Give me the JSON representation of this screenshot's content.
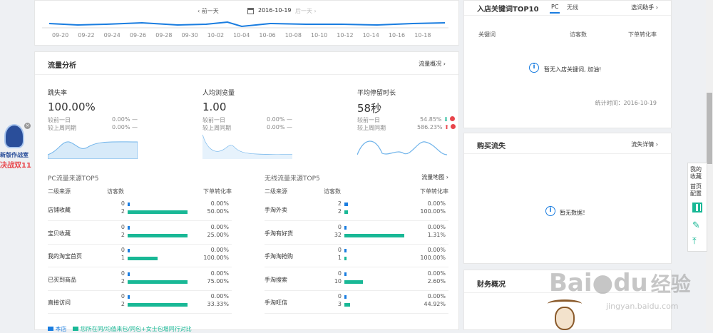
{
  "date_nav": {
    "prev": "前一天",
    "date": "2016-10-19",
    "next": "后一天"
  },
  "top_axis": {
    "ticks": [
      "09-20",
      "09-22",
      "09-24",
      "09-26",
      "09-28",
      "09-30",
      "10-02",
      "10-04",
      "10-06",
      "10-08",
      "10-10",
      "10-12",
      "10-14",
      "10-16",
      "10-18"
    ]
  },
  "traffic": {
    "title": "流量分析",
    "overview_link": "流量概况",
    "metrics": [
      {
        "label": "跳失率",
        "value": "100.00%",
        "day_label": "较前一日",
        "day_val": "0.00%",
        "week_label": "较上周同期",
        "week_val": "0.00%"
      },
      {
        "label": "人均浏览量",
        "value": "1.00",
        "day_label": "较前一日",
        "day_val": "0.00%",
        "week_label": "较上周同期",
        "week_val": "0.00%"
      },
      {
        "label": "平均停留时长",
        "value": "58秒",
        "day_label": "较前一日",
        "day_val": "54.85%",
        "week_label": "较上周同期",
        "week_val": "586.23%"
      }
    ],
    "dash": "—",
    "pc_top5": {
      "title": "PC流量来源TOP5",
      "cols": [
        "二级来源",
        "访客数",
        "下单转化率"
      ],
      "rows": [
        {
          "name": "店铺收藏",
          "a": "0",
          "b": "2",
          "ra": "0.00%",
          "rb": "50.00%",
          "fa": 0.0,
          "fb": 1.0
        },
        {
          "name": "宝贝收藏",
          "a": "0",
          "b": "2",
          "ra": "0.00%",
          "rb": "25.00%",
          "fa": 0.0,
          "fb": 1.0
        },
        {
          "name": "我的淘宝首页",
          "a": "0",
          "b": "1",
          "ra": "0.00%",
          "rb": "100.00%",
          "fa": 0.0,
          "fb": 0.5
        },
        {
          "name": "已买到商品",
          "a": "0",
          "b": "2",
          "ra": "0.00%",
          "rb": "75.00%",
          "fa": 0.0,
          "fb": 1.0
        },
        {
          "name": "直接访问",
          "a": "0",
          "b": "2",
          "ra": "0.00%",
          "rb": "33.33%",
          "fa": 0.0,
          "fb": 1.0
        }
      ]
    },
    "mobile_top5": {
      "title": "无线流量来源TOP5",
      "map_link": "流量地图",
      "cols": [
        "二级来源",
        "访客数",
        "下单转化率"
      ],
      "rows": [
        {
          "name": "手淘外卖",
          "a": "2",
          "b": "2",
          "ra": "0.00%",
          "rb": "100.00%",
          "fa": 0.06,
          "fb": 0.06
        },
        {
          "name": "手淘有好货",
          "a": "0",
          "b": "32",
          "ra": "0.00%",
          "rb": "1.31%",
          "fa": 0.0,
          "fb": 1.0
        },
        {
          "name": "手淘淘抢购",
          "a": "0",
          "b": "1",
          "ra": "0.00%",
          "rb": "100.00%",
          "fa": 0.0,
          "fb": 0.03
        },
        {
          "name": "手淘搜索",
          "a": "0",
          "b": "10",
          "ra": "0.00%",
          "rb": "2.60%",
          "fa": 0.0,
          "fb": 0.31
        },
        {
          "name": "手淘旺信",
          "a": "0",
          "b": "3",
          "ra": "0.00%",
          "rb": "44.92%",
          "fa": 0.0,
          "fb": 0.09
        }
      ]
    },
    "legend": {
      "a": "本店",
      "b": "您所在同/均值来包/同包+女士包增同行对比"
    }
  },
  "keywords": {
    "title": "入店关键词TOP10",
    "tabs": [
      "PC",
      "无线"
    ],
    "helper": "选词助手",
    "cols": [
      "关键词",
      "访客数",
      "下单转化率"
    ],
    "empty": "暂无入店关键词, 加油!",
    "stat_time": "统计时间：2016-10-19"
  },
  "purchase_loss": {
    "title": "购买流失",
    "link": "流失详情",
    "empty": "暂无数据！"
  },
  "finance": {
    "title": "财务概况"
  },
  "ad": {
    "line1": "新版作战室",
    "line2": "决战双11"
  },
  "side": {
    "fav": "我的收藏",
    "home": "首页配置"
  },
  "watermark": {
    "brand": "Bai",
    "brand2": "du",
    "cn": "经验",
    "url": "jingyan.baidu.com"
  },
  "colors": {
    "blue": "#1a7de0",
    "green": "#19b896",
    "line": "#4aa3e8"
  }
}
